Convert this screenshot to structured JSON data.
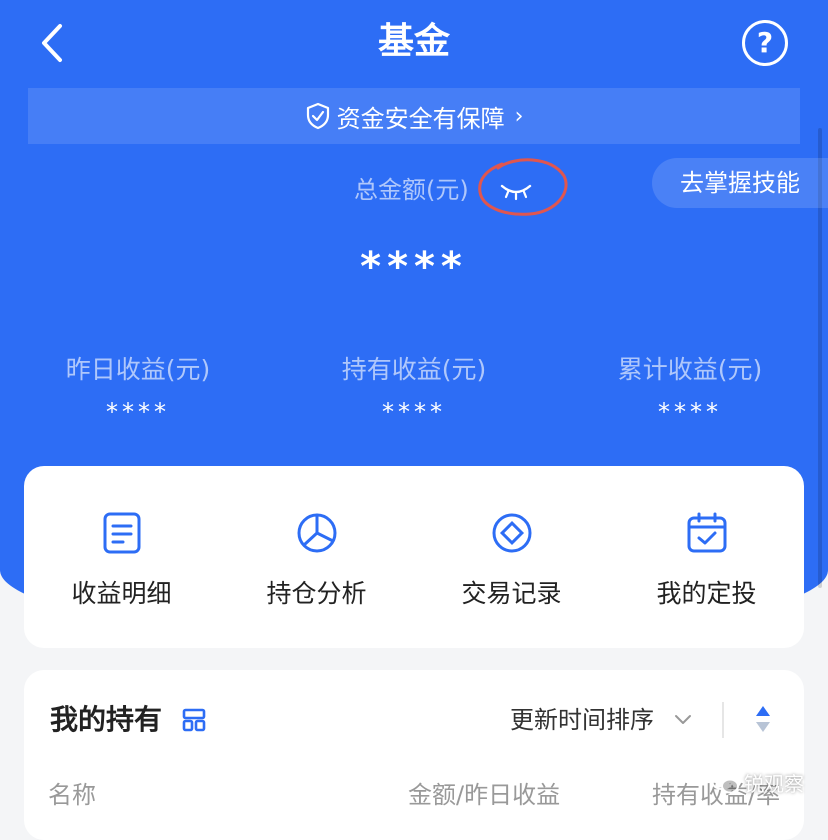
{
  "header": {
    "title": "基金",
    "help_label": "?"
  },
  "security_banner": {
    "label": "资金安全有保障",
    "chevron": "›"
  },
  "skill_pill": {
    "label": "去掌握技能"
  },
  "balance": {
    "total_label": "总金额(元)",
    "total_value": "****",
    "eye_icon": "eye-closed-icon"
  },
  "stats": [
    {
      "label": "昨日收益(元)",
      "value": "****"
    },
    {
      "label": "持有收益(元)",
      "value": "****"
    },
    {
      "label": "累计收益(元)",
      "value": "****"
    }
  ],
  "quick_actions": [
    {
      "label": "收益明细",
      "icon": "document-icon"
    },
    {
      "label": "持仓分析",
      "icon": "pie-chart-icon"
    },
    {
      "label": "交易记录",
      "icon": "record-icon"
    },
    {
      "label": "我的定投",
      "icon": "calendar-check-icon"
    }
  ],
  "holdings": {
    "title": "我的持有",
    "sort_label": "更新时间排序",
    "columns": [
      "名称",
      "金额/昨日收益",
      "持有收益/率"
    ]
  },
  "watermark": {
    "label": "锐观察"
  },
  "colors": {
    "primary": "#2d6df5",
    "card": "#ffffff",
    "background": "#f4f5f7",
    "annotation": "#e0564f"
  }
}
